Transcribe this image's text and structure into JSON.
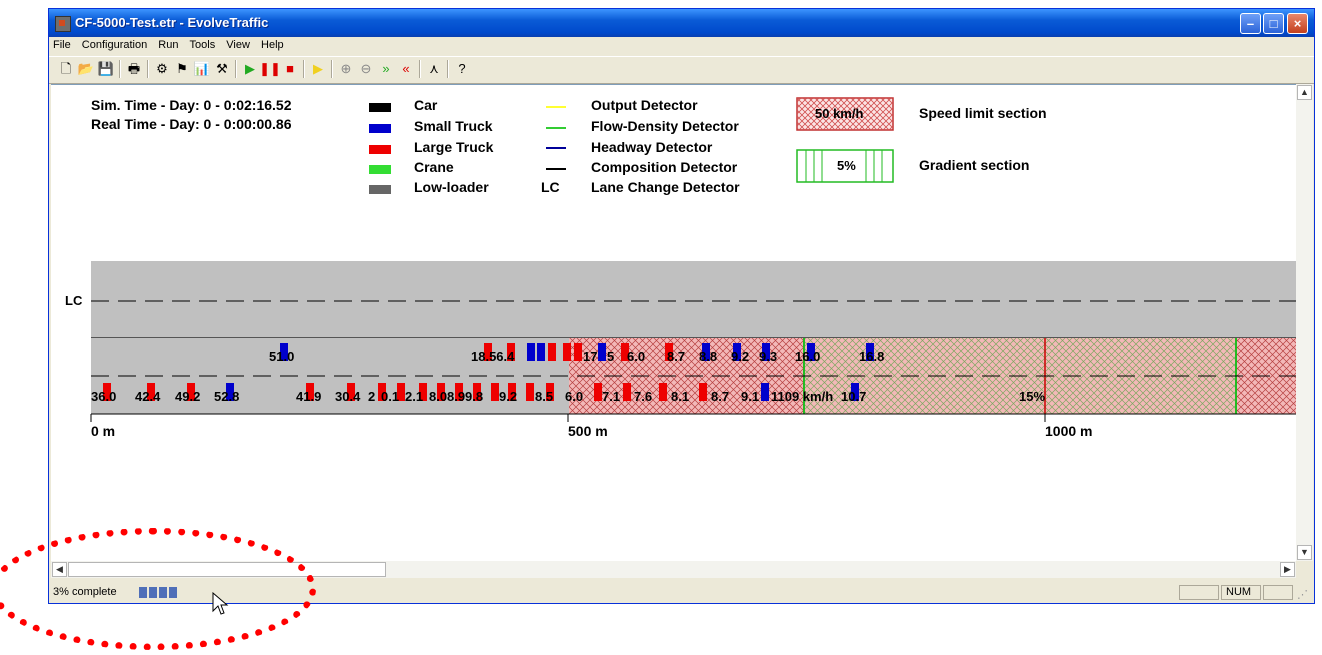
{
  "window": {
    "title": "CF-5000-Test.etr - EvolveTraffic"
  },
  "menu": [
    "File",
    "Configuration",
    "Run",
    "Tools",
    "View",
    "Help"
  ],
  "toolbar_icons": [
    "new-icon",
    "open-icon",
    "save-icon",
    "print-icon",
    "config-icon",
    "run-settings-icon",
    "chart-icon",
    "options-icon",
    "play-icon",
    "pause-icon",
    "stop-icon",
    "step-icon",
    "zoom-in-icon",
    "zoom-out-icon",
    "fast-forward-icon",
    "rewind-icon",
    "tool-icon",
    "help-icon"
  ],
  "sim": {
    "sim_time": "Sim. Time - Day: 0 - 0:02:16.52",
    "real_time": "Real Time - Day: 0 - 0:00:00.86"
  },
  "legend": {
    "vehicles": [
      {
        "label": "Car",
        "color": "#000000"
      },
      {
        "label": "Small Truck",
        "color": "#0000cc"
      },
      {
        "label": "Large Truck",
        "color": "#ee0000"
      },
      {
        "label": "Crane",
        "color": "#33dd33"
      },
      {
        "label": "Low-loader",
        "color": "#666666"
      }
    ],
    "detectors": [
      {
        "label": "Output Detector",
        "color": "#ffff33",
        "symbol": "line"
      },
      {
        "label": "Flow-Density Detector",
        "color": "#33cc33",
        "symbol": "line"
      },
      {
        "label": "Headway Detector",
        "color": "#000099",
        "symbol": "line"
      },
      {
        "label": "Composition Detector",
        "color": "#000000",
        "symbol": "line"
      },
      {
        "label": "Lane Change Detector",
        "symbol": "LC"
      }
    ],
    "sections": [
      {
        "sample": "50 km/h",
        "label": "Speed limit section"
      },
      {
        "sample": "5%",
        "label": "Gradient section"
      }
    ]
  },
  "road": {
    "lc_label": "LC",
    "top_lane_labels": [
      "51.0",
      "18.56.4",
      "17",
      "5",
      "6.0",
      "8.7",
      "8.8",
      "9.2",
      "9.3",
      "16.0",
      "16.8"
    ],
    "bottom_lane_labels": [
      "36.0",
      "42.4",
      "49.2",
      "52.8",
      "41.9",
      "30.4",
      "2",
      "0.1",
      "2.1",
      "8.0",
      "8.9",
      "9.8",
      "9.2",
      "8.5",
      "6.0",
      "7.1",
      "7.6",
      "8.1",
      "8.7",
      "9.1",
      "1109 km/h",
      "10.7",
      "15%"
    ],
    "axis_labels": [
      "0 m",
      "500 m",
      "1000 m"
    ]
  },
  "status": {
    "progress_text": "3% complete",
    "progress": 0.03,
    "num": "NUM"
  }
}
